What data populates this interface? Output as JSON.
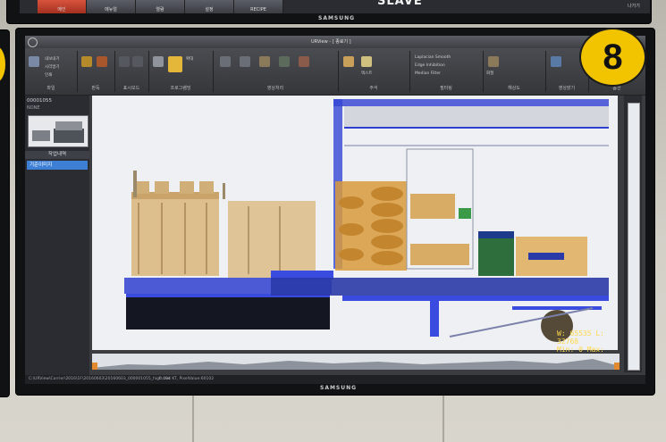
{
  "top_monitor": {
    "buttons": [
      "메인",
      "메뉴얼",
      "열람",
      "설정",
      "RECIPE"
    ],
    "label": "SLAVE",
    "right_text": "나가기",
    "brand": "SAMSUNG"
  },
  "app": {
    "window_title": "URView - [ 종료기 ]",
    "ribbon_groups": [
      "파일",
      "판독",
      "표시모드",
      "프로그램밍",
      "영상처리",
      "주석",
      "필터링",
      "해상도",
      "영상밝기",
      "옵션"
    ],
    "ribbon_items": [
      "내보내기",
      "시리얼기",
      "인쇄",
      "확대",
      "Edge Inhibition",
      "Median Filter",
      "Laplacian Smooth",
      "화질",
      "텍스트"
    ],
    "sidebar": {
      "scan_id": "00001055",
      "scan_sub": "NONE",
      "history_header": "작업내역",
      "history_item": "기준이미지"
    },
    "readout": {
      "line1": "W: 65535  L: 32768",
      "line2": "Min: 0  Max: 65535"
    },
    "status_text": "C:\\URView\\Carrier\\2016\\1F\\20160603\\20160603_000001055_high.raw",
    "status_right": "0.094 KT, PixelValue:60102",
    "brand": "SAMSUNG"
  },
  "overlay_badge": "8",
  "colors": {
    "accent": "#f2c400",
    "selection": "#3e7fd6",
    "xray_orange": "#d89b3c",
    "xray_blue": "#2f3fd0"
  }
}
